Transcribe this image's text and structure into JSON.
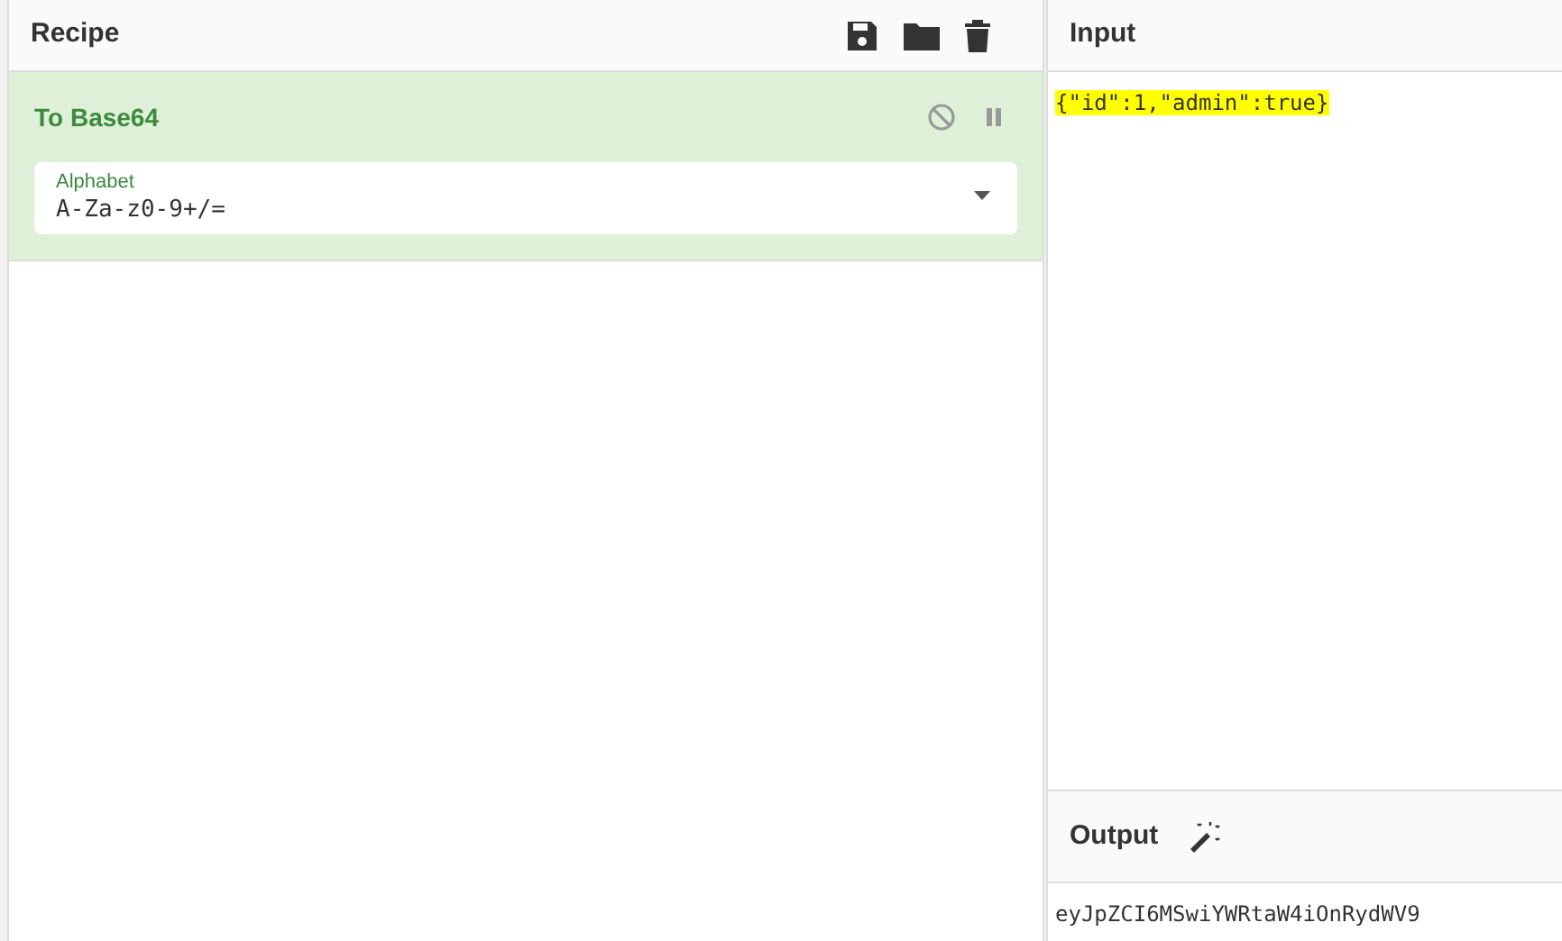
{
  "recipe": {
    "title": "Recipe",
    "operations": [
      {
        "name": "To Base64",
        "disabled": false,
        "paused": false,
        "fields": [
          {
            "label": "Alphabet",
            "value": "A-Za-z0-9+/="
          }
        ]
      }
    ]
  },
  "input": {
    "title": "Input",
    "text": "{\"id\":1,\"admin\":true}",
    "highlighted": true
  },
  "output": {
    "title": "Output",
    "text": "eyJpZCI6MSwiYWRtaW4iOnRydWV9"
  }
}
